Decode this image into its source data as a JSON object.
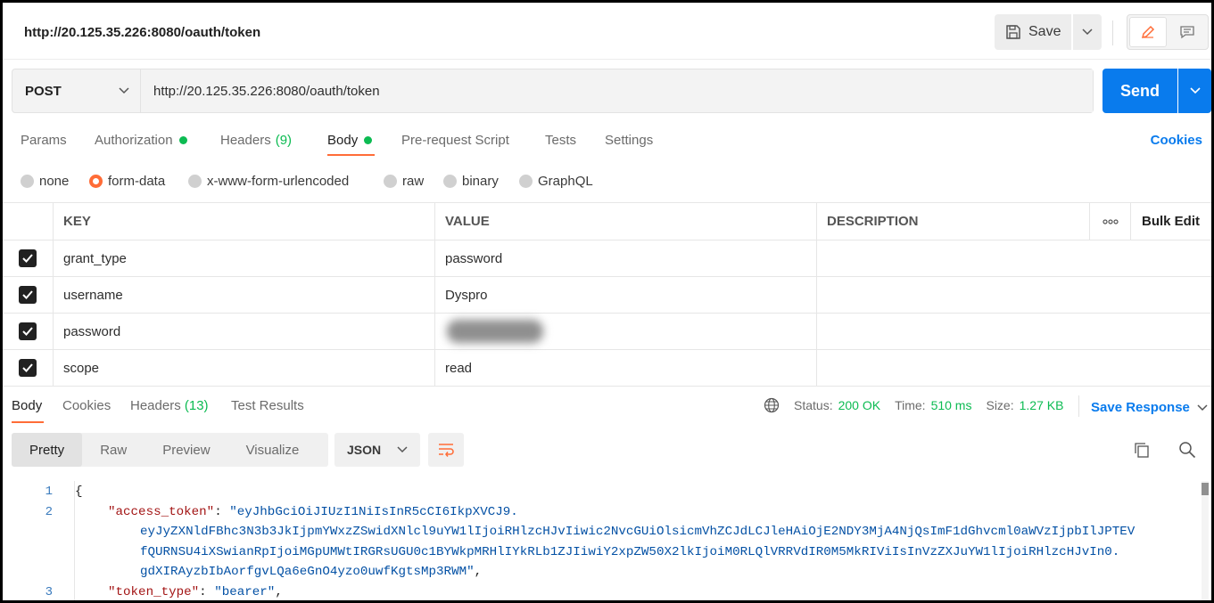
{
  "title_url": "http://20.125.35.226:8080/oauth/token",
  "toolbar": {
    "save_label": "Save",
    "save_icon": "floppy-icon",
    "edit_icon": "pencil-icon",
    "comment_icon": "comment-icon"
  },
  "request": {
    "method": "POST",
    "url": "http://20.125.35.226:8080/oauth/token",
    "send_label": "Send"
  },
  "request_tabs": {
    "params": "Params",
    "authorization": "Authorization",
    "headers": "Headers",
    "headers_count": "(9)",
    "body": "Body",
    "prerequest": "Pre-request Script",
    "tests": "Tests",
    "settings": "Settings",
    "cookies": "Cookies"
  },
  "body_types": {
    "none": "none",
    "form_data": "form-data",
    "urlencoded": "x-www-form-urlencoded",
    "raw": "raw",
    "binary": "binary",
    "graphql": "GraphQL",
    "selected": "form-data"
  },
  "table": {
    "headers": {
      "key": "KEY",
      "value": "VALUE",
      "description": "DESCRIPTION",
      "more": "ooo",
      "bulk_edit": "Bulk Edit"
    },
    "rows": [
      {
        "key": "grant_type",
        "value": "password",
        "description": "",
        "checked": true
      },
      {
        "key": "username",
        "value": "Dyspro",
        "description": "",
        "checked": true
      },
      {
        "key": "password",
        "value": "",
        "description": "",
        "checked": true,
        "redacted": true
      },
      {
        "key": "scope",
        "value": "read",
        "description": "",
        "checked": true
      }
    ]
  },
  "response": {
    "tabs": {
      "body": "Body",
      "cookies": "Cookies",
      "headers": "Headers",
      "headers_count": "(13)",
      "test_results": "Test Results"
    },
    "status_label": "Status:",
    "status_value": "200 OK",
    "time_label": "Time:",
    "time_value": "510 ms",
    "size_label": "Size:",
    "size_value": "1.27 KB",
    "save_response": "Save Response",
    "views": {
      "pretty": "Pretty",
      "raw": "Raw",
      "preview": "Preview",
      "visualize": "Visualize"
    },
    "format": "JSON"
  },
  "code": {
    "line_numbers": [
      "1",
      "2",
      "3"
    ],
    "brace_open": "{",
    "access_key": "\"access_token\"",
    "access_val_1": "\"eyJhbGciOiJIUzI1NiIsInR5cCI6IkpXVCJ9.",
    "access_val_2": "eyJyZXNldFBhc3N3b3JkIjpmYWxzZSwidXNlcl9uYW1lIjoiRHlzcHJvIiwic2NvcGUiOlsicmVhZCJdLCJleHAiOjE2NDY3MjA4NjQsImF1dGhvcml0aWVzIjpbIlJPTEV",
    "access_val_3": "fQURNSU4iXSwianRpIjoiMGpUMWtIRGRsUGU0c1BYWkpMRHlIYkRLb1ZJIiwiY2xpZW50X2lkIjoiM0RLQlVRRVdIR0M5MkRIViIsInVzZXJuYW1lIjoiRHlzcHJvIn0.",
    "access_val_4": "gdXIRAyzbIbAorfgvLQa6eGnO4yzo0uwfKgtsMp3RWM\"",
    "token_type_key": "\"token_type\"",
    "token_type_val": "\"bearer\""
  },
  "colors": {
    "accent": "#ff6c37",
    "primary": "#097bed",
    "success": "#0cbb52"
  }
}
